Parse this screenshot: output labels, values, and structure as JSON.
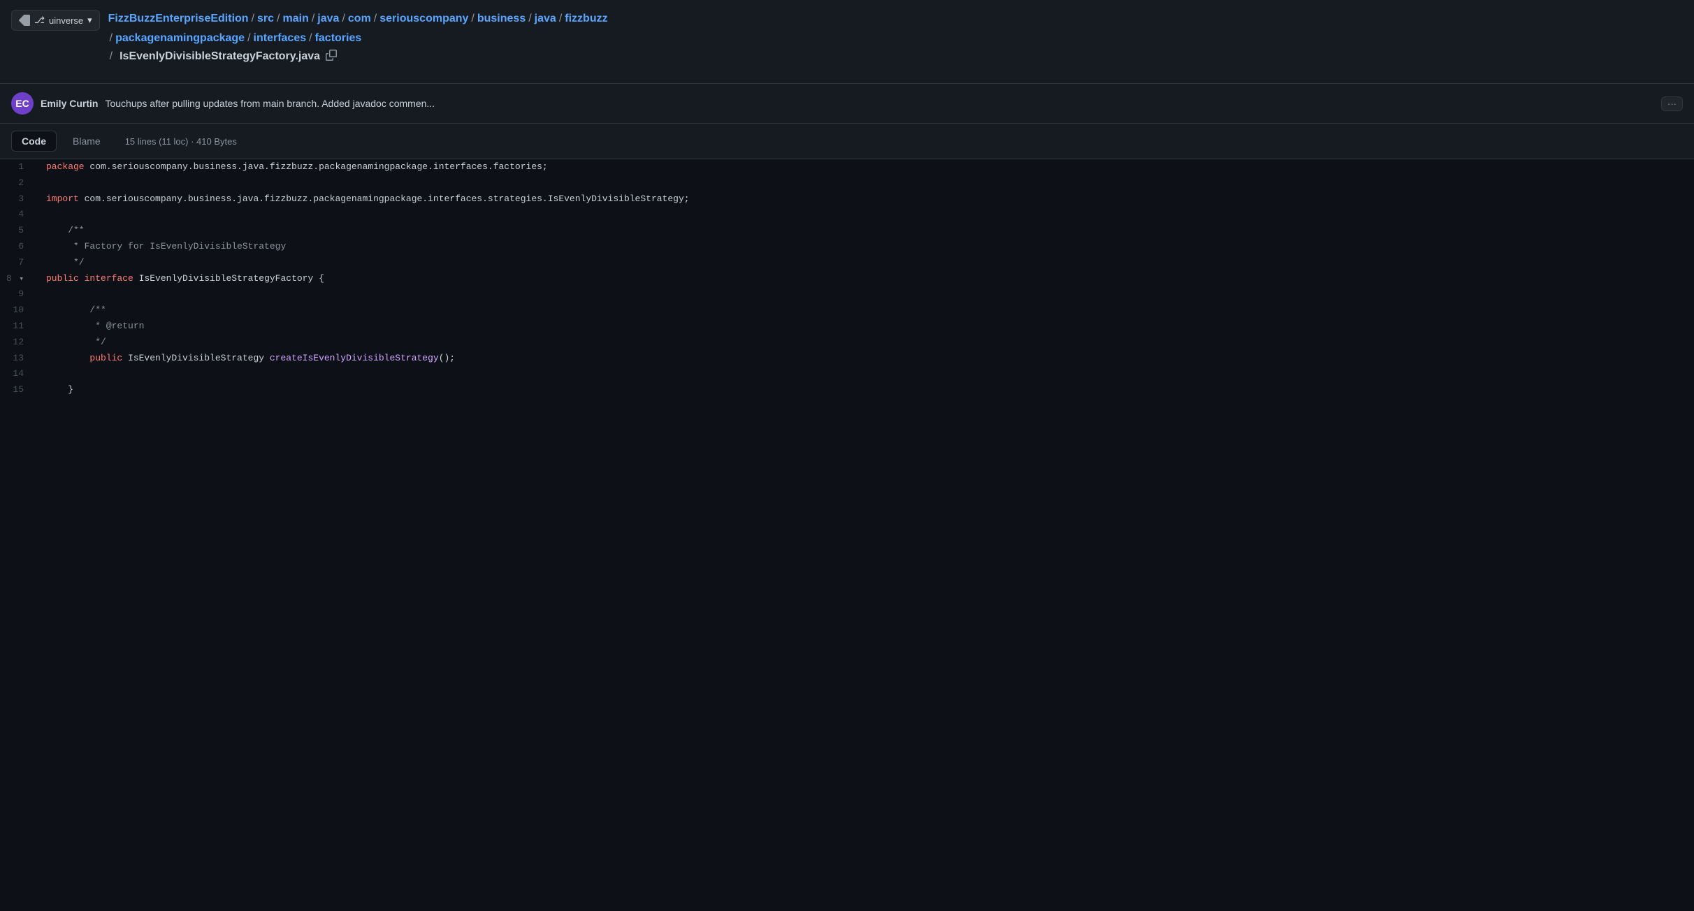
{
  "sidebar_toggle": {
    "icon": "⊞",
    "label": "uinverse",
    "chevron": "▾"
  },
  "breadcrumb": {
    "parts": [
      {
        "text": "FizzBuzzEnterpriseEdition",
        "sep": "/"
      },
      {
        "text": "src",
        "sep": "/"
      },
      {
        "text": "main",
        "sep": "/"
      },
      {
        "text": "java",
        "sep": "/"
      },
      {
        "text": "com",
        "sep": "/"
      },
      {
        "text": "seriouscompany",
        "sep": "/"
      },
      {
        "text": "business",
        "sep": "/"
      },
      {
        "text": "java",
        "sep": "/"
      },
      {
        "text": "fizzbuzz",
        "sep": "/"
      }
    ],
    "parts2": [
      {
        "text": "packagenamingpackage",
        "sep": "/"
      },
      {
        "text": "interfaces",
        "sep": "/"
      },
      {
        "text": "factories",
        "sep": ""
      }
    ],
    "filename": "IsEvenlyDivisibleStrategyFactory.java"
  },
  "commit": {
    "author": "Emily Curtin",
    "message": "Touchups after pulling updates from main branch. Added javadoc commen...",
    "more_label": "···"
  },
  "toolbar": {
    "tab_code": "Code",
    "tab_blame": "Blame",
    "meta": "15 lines (11 loc) · 410 Bytes"
  },
  "code_lines": [
    {
      "num": 1,
      "expand": false,
      "tokens": [
        {
          "cls": "kw-package",
          "t": "package"
        },
        {
          "cls": "text-normal",
          "t": " com.seriouscompany.business.java.fizzbuzz.packagenamingpackage.interfaces.factories;"
        }
      ]
    },
    {
      "num": 2,
      "expand": false,
      "tokens": []
    },
    {
      "num": 3,
      "expand": false,
      "tokens": [
        {
          "cls": "kw-import",
          "t": "import"
        },
        {
          "cls": "text-normal",
          "t": " com.seriouscompany.business.java.fizzbuzz.packagenamingpackage.interfaces.strategies.IsEvenlyDivisibleStrategy;"
        }
      ]
    },
    {
      "num": 4,
      "expand": false,
      "tokens": []
    },
    {
      "num": 5,
      "expand": false,
      "tokens": [
        {
          "cls": "comment",
          "t": "    /**"
        }
      ]
    },
    {
      "num": 6,
      "expand": false,
      "tokens": [
        {
          "cls": "comment",
          "t": "     * Factory for IsEvenlyDivisibleStrategy"
        }
      ]
    },
    {
      "num": 7,
      "expand": false,
      "tokens": [
        {
          "cls": "comment",
          "t": "     */"
        }
      ]
    },
    {
      "num": 8,
      "expand": true,
      "tokens": [
        {
          "cls": "kw-public",
          "t": "public"
        },
        {
          "cls": "text-normal",
          "t": " "
        },
        {
          "cls": "kw-interface",
          "t": "interface"
        },
        {
          "cls": "text-normal",
          "t": " IsEvenlyDivisibleStrategyFactory {"
        }
      ]
    },
    {
      "num": 9,
      "expand": false,
      "tokens": []
    },
    {
      "num": 10,
      "expand": false,
      "tokens": [
        {
          "cls": "comment",
          "t": "        /**"
        }
      ]
    },
    {
      "num": 11,
      "expand": false,
      "tokens": [
        {
          "cls": "comment",
          "t": "         * @return"
        }
      ]
    },
    {
      "num": 12,
      "expand": false,
      "tokens": [
        {
          "cls": "comment",
          "t": "         */"
        }
      ]
    },
    {
      "num": 13,
      "expand": false,
      "tokens": [
        {
          "cls": "kw-public",
          "t": "        public"
        },
        {
          "cls": "text-normal",
          "t": " IsEvenlyDivisibleStrategy "
        },
        {
          "cls": "fn-name",
          "t": "createIsEvenlyDivisibleStrategy"
        },
        {
          "cls": "text-normal",
          "t": "();"
        }
      ]
    },
    {
      "num": 14,
      "expand": false,
      "tokens": []
    },
    {
      "num": 15,
      "expand": false,
      "tokens": [
        {
          "cls": "text-normal",
          "t": "    }"
        }
      ]
    }
  ]
}
